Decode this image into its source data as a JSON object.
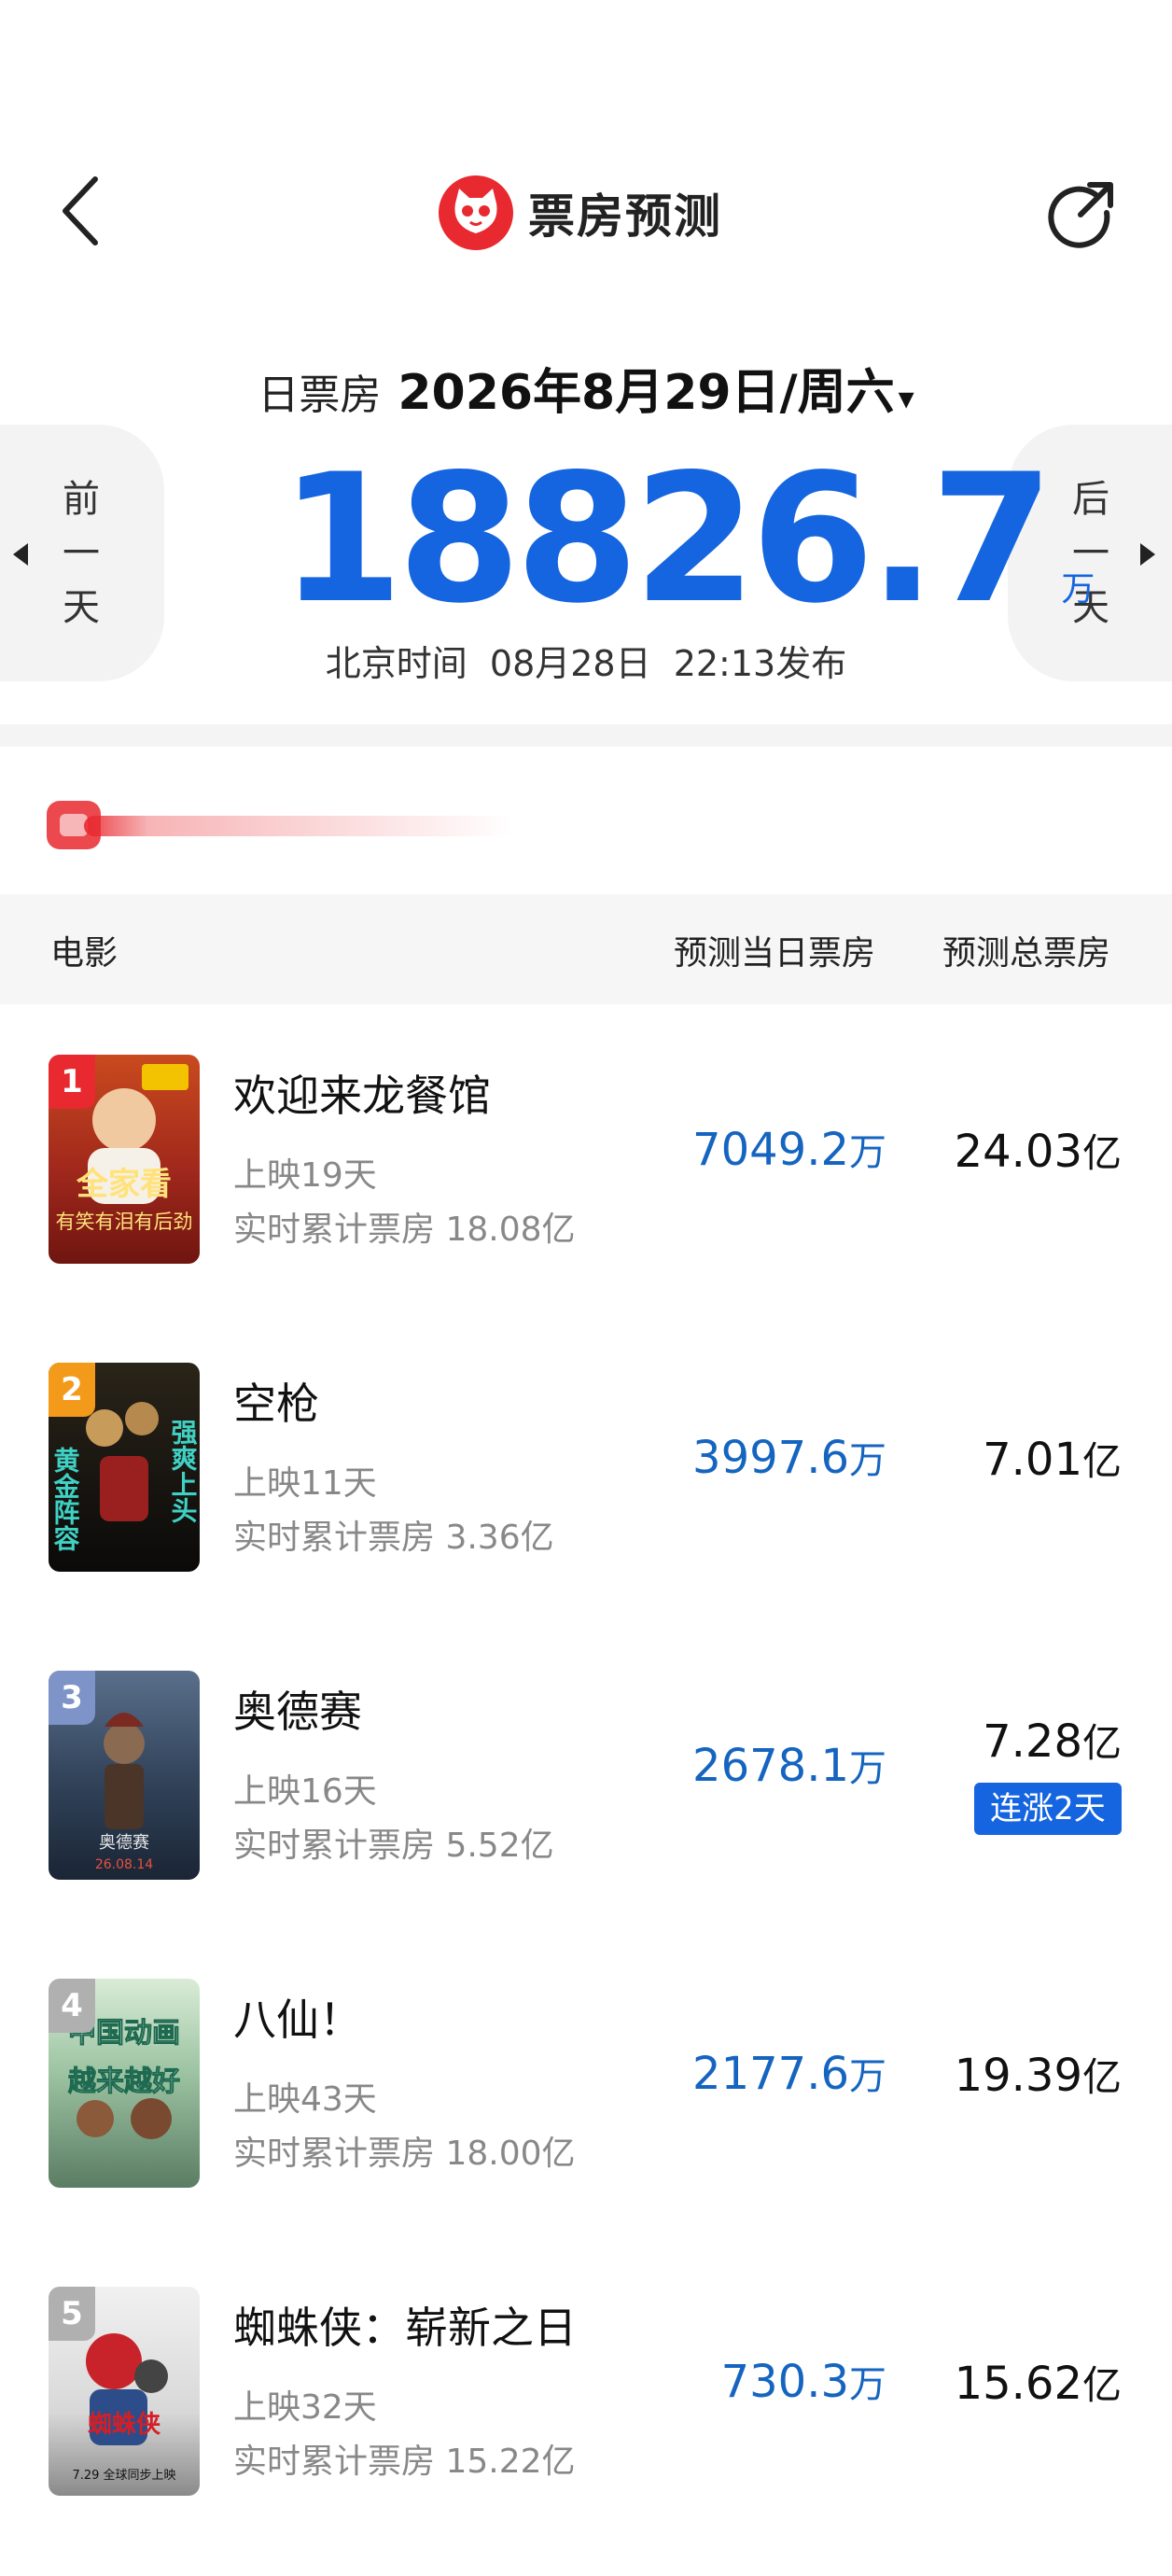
{
  "header": {
    "title": "票房预测",
    "colors": {
      "brand": "#e8292f",
      "accent": "#1565e0"
    }
  },
  "date": {
    "label": "日票房",
    "value": "2026年8月29日/周六",
    "caret": "▾"
  },
  "nav": {
    "prev_label": "前一天",
    "next_label": "后一天"
  },
  "summary": {
    "total": "18826.7",
    "unit": "万",
    "publish_label": "北京时间",
    "publish_date": "08月28日",
    "publish_time": "22:13发布"
  },
  "table": {
    "col_movie": "电影",
    "col_day": "预测当日票房",
    "col_total": "预测总票房"
  },
  "movies": [
    {
      "rank": "1",
      "name": "欢迎来龙餐馆",
      "days": "上映19天",
      "cumulative": "实时累计票房 18.08亿",
      "day_value": "7049.2",
      "day_unit": "万",
      "total_value": "24.03",
      "total_unit": "亿",
      "poster_text": "全家看",
      "poster_text2": "有笑有泪有后劲",
      "badge_color": "#e8292f"
    },
    {
      "rank": "2",
      "name": "空枪",
      "days": "上映11天",
      "cumulative": "实时累计票房 3.36亿",
      "day_value": "3997.6",
      "day_unit": "万",
      "total_value": "7.01",
      "total_unit": "亿",
      "poster_text": "黄金阵容",
      "poster_text2": "强爽上头",
      "badge_color": "#f49a1a"
    },
    {
      "rank": "3",
      "name": "奥德赛",
      "days": "上映16天",
      "cumulative": "实时累计票房 5.52亿",
      "day_value": "2678.1",
      "day_unit": "万",
      "total_value": "7.28",
      "total_unit": "亿",
      "streak": "连涨2天",
      "poster_text": "奥德赛",
      "poster_text2": "26.08.14",
      "badge_color": "#7e93c8"
    },
    {
      "rank": "4",
      "name": "八仙！",
      "days": "上映43天",
      "cumulative": "实时累计票房 18.00亿",
      "day_value": "2177.6",
      "day_unit": "万",
      "total_value": "19.39",
      "total_unit": "亿",
      "poster_text": "中国动画",
      "poster_text2": "越来越好",
      "badge_color": "#b0b0b0"
    },
    {
      "rank": "5",
      "name": "蜘蛛侠：崭新之日",
      "days": "上映32天",
      "cumulative": "实时累计票房 15.22亿",
      "day_value": "730.3",
      "day_unit": "万",
      "total_value": "15.62",
      "total_unit": "亿",
      "poster_text": "蜘蛛侠",
      "poster_text2": "7.29 全球同步上映",
      "badge_color": "#b0b0b0"
    }
  ]
}
